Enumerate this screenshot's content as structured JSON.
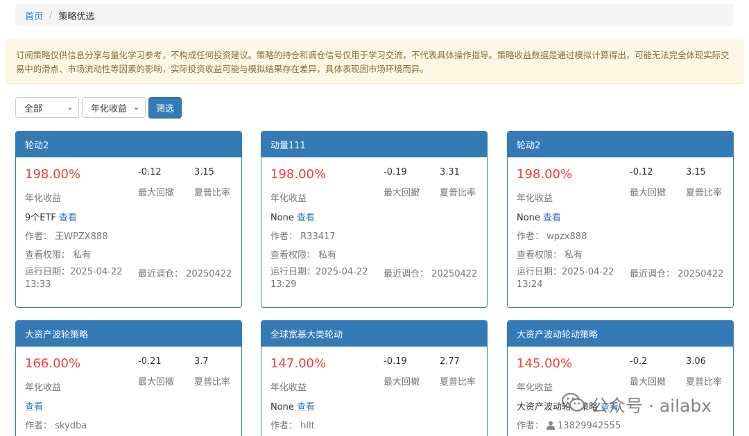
{
  "breadcrumb": {
    "home": "首页",
    "separator": "/",
    "current": "策略优选"
  },
  "notice": "订阅策略仅供信息分享与量化学习参考，不构成任何投资建议。策略的持仓和调仓信号仅用于学习交流，不代表具体操作指导。策略收益数据是通过模拟计算得出，可能无法完全体现实际交易中的滑点、市场流动性等因素的影响，实际投资收益可能与模拟结果存在差异，具体表现因市场环境而异。",
  "filters": {
    "category": "全部",
    "sort": "年化收益",
    "button": "筛选"
  },
  "labels": {
    "annual_return": "年化收益",
    "max_drawdown": "最大回撤",
    "sharpe": "夏普比率",
    "view": "查看",
    "author_prefix": "作者：",
    "permission_prefix": "查看权限：",
    "run_date_prefix": "运行日期：",
    "rebalance_prefix": "最近调仓："
  },
  "cards": [
    {
      "title": "轮动2",
      "annual_return": "198.00%",
      "max_drawdown": "-0.12",
      "sharpe": "3.15",
      "desc": "9个ETF",
      "author": "王WPZX888",
      "permission": "私有",
      "run_date_line1": "2025-04-22",
      "run_date_line2": "13:33",
      "rebalance": "20250422"
    },
    {
      "title": "动量111",
      "annual_return": "198.00%",
      "max_drawdown": "-0.19",
      "sharpe": "3.31",
      "desc": "None",
      "author": "R33417",
      "permission": "私有",
      "run_date_line1": "2025-04-22",
      "run_date_line2": "13:29",
      "rebalance": "20250422"
    },
    {
      "title": "轮动2",
      "annual_return": "198.00%",
      "max_drawdown": "-0.12",
      "sharpe": "3.15",
      "desc": "None",
      "author": "wpzx888",
      "permission": "私有",
      "run_date_line1": "2025-04-22",
      "run_date_line2": "13:24",
      "rebalance": "20250422"
    },
    {
      "title": "大资产波轮策略",
      "annual_return": "166.00%",
      "max_drawdown": "-0.21",
      "sharpe": "3.7",
      "desc": "",
      "author": "skydba"
    },
    {
      "title": "全球宽基大类轮动",
      "annual_return": "147.00%",
      "max_drawdown": "-0.19",
      "sharpe": "2.77",
      "desc": "None",
      "author": "hllt"
    },
    {
      "title": "大资产波动轮动策略",
      "annual_return": "145.00%",
      "max_drawdown": "-0.2",
      "sharpe": "3.06",
      "desc": "大资产波动轮动策略",
      "author": "13829942555"
    }
  ],
  "watermark": {
    "text": "公众号 · ailabx",
    "icon": "wechat-icon"
  }
}
